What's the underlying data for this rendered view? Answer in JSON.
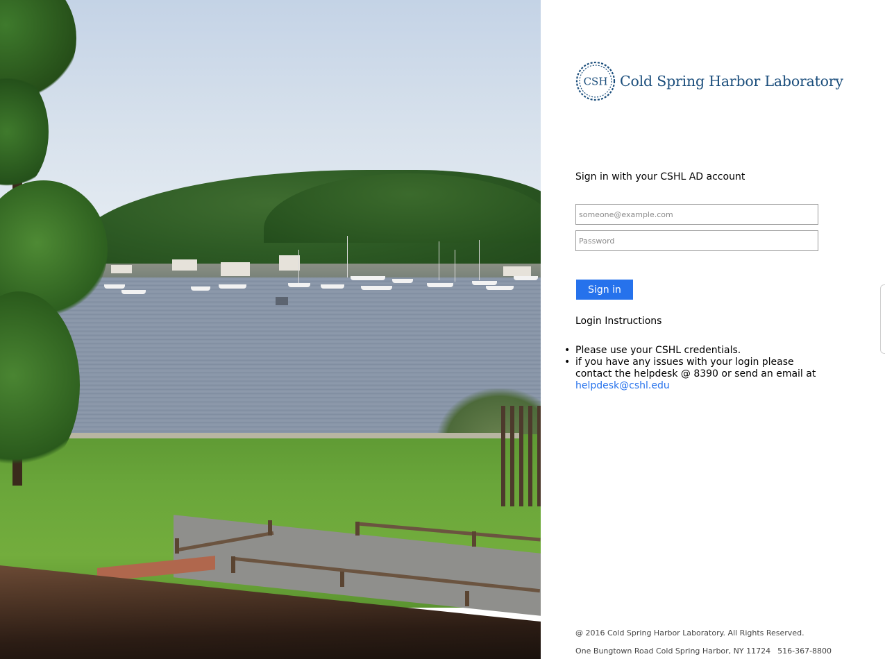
{
  "background_photo": {
    "description_icon": "harbor-landscape-photo"
  },
  "logo": {
    "seal_text": "CSH",
    "org_name": "Cold Spring Harbor Laboratory",
    "color": "#1b4e7c"
  },
  "signin": {
    "title": "Sign in with your CSHL AD account",
    "username_placeholder": "someone@example.com",
    "username_value": "",
    "password_placeholder": "Password",
    "password_value": "",
    "button_label": "Sign in",
    "button_color": "#2672ec"
  },
  "instructions": {
    "title": "Login Instructions",
    "items": [
      "Please use your CSHL credentials.",
      "if you have any issues with your login please contact the helpdesk @ 8390 or send an email at"
    ],
    "email_link": "helpdesk@cshl.edu",
    "link_color": "#2672ec"
  },
  "footer": {
    "copyright": "@ 2016 Cold Spring Harbor Laboratory. All Rights Reserved.",
    "address": "One Bungtown Road Cold Spring Harbor, NY 11724",
    "phone": "516-367-8800"
  }
}
